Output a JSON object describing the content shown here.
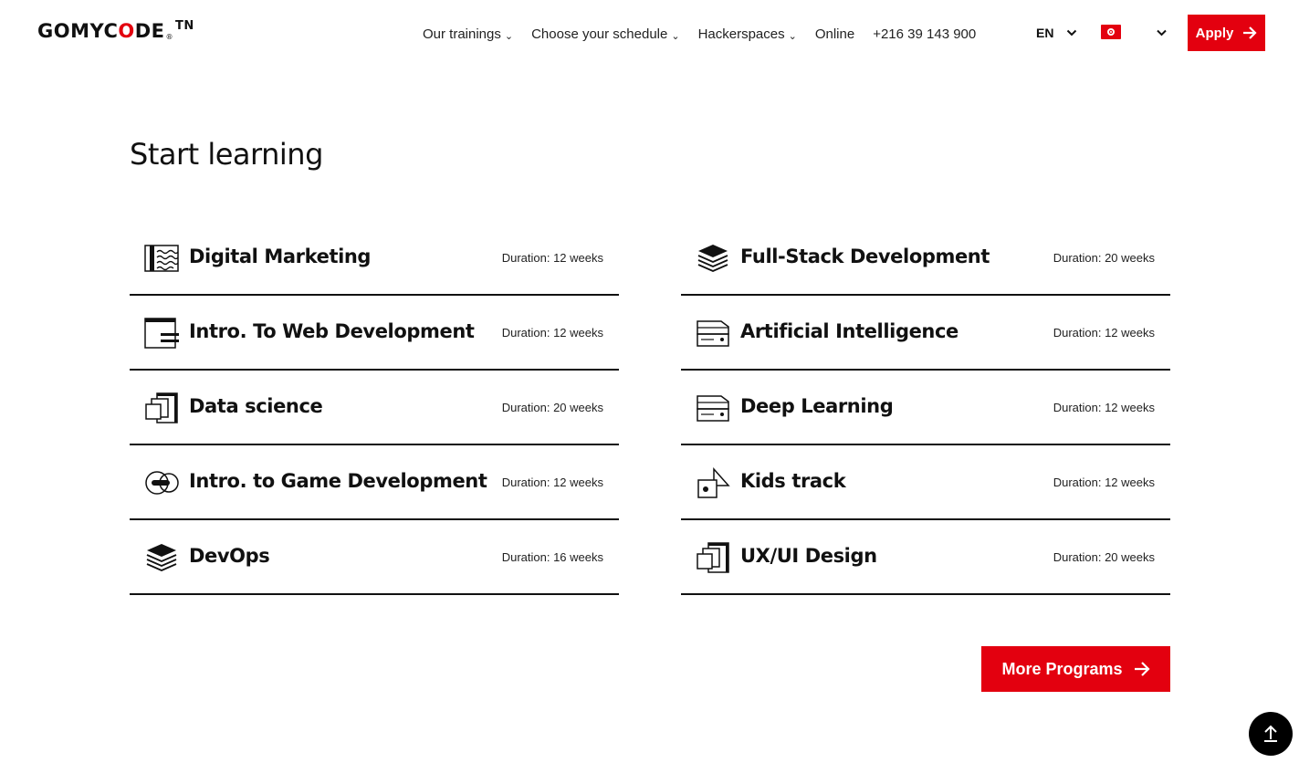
{
  "header": {
    "logo": {
      "text_before": "GOMYC",
      "text_o": "O",
      "text_after": "DE",
      "reg": "®",
      "suffix": "TN"
    },
    "nav": [
      {
        "label": "Our trainings",
        "has_dropdown": true
      },
      {
        "label": "Choose your schedule",
        "has_dropdown": true
      },
      {
        "label": "Hackerspaces",
        "has_dropdown": true
      },
      {
        "label": "Online",
        "has_dropdown": false
      },
      {
        "label": "+216 39 143 900",
        "has_dropdown": false
      }
    ],
    "language": "EN",
    "country_flag": "tunisia-flag-icon",
    "apply_label": "Apply"
  },
  "main": {
    "title": "Start learning",
    "programs_left": [
      {
        "name": "Digital Marketing",
        "duration": "Duration: 12 weeks",
        "icon": "waves-book-icon"
      },
      {
        "name": "Intro. To Web Development",
        "duration": "Duration: 12 weeks",
        "icon": "browser-window-icon"
      },
      {
        "name": "Data science",
        "duration": "Duration: 20 weeks",
        "icon": "stacked-squares-icon"
      },
      {
        "name": "Intro. to Game Development",
        "duration": "Duration: 12 weeks",
        "icon": "toggle-circle-icon"
      },
      {
        "name": "DevOps",
        "duration": "Duration: 16 weeks",
        "icon": "layers-icon"
      }
    ],
    "programs_right": [
      {
        "name": "Full-Stack Development",
        "duration": "Duration: 20 weeks",
        "icon": "layers-icon"
      },
      {
        "name": "Artificial Intelligence",
        "duration": "Duration: 12 weeks",
        "icon": "server-icon"
      },
      {
        "name": "Deep Learning",
        "duration": "Duration: 12 weeks",
        "icon": "server-icon"
      },
      {
        "name": "Kids track",
        "duration": "Duration: 12 weeks",
        "icon": "shapes-icon"
      },
      {
        "name": "UX/UI Design",
        "duration": "Duration: 20 weeks",
        "icon": "stacked-squares-icon"
      }
    ],
    "more_programs_label": "More Programs"
  },
  "colors": {
    "accent": "#e3000f",
    "text": "#111111",
    "background": "#ffffff"
  }
}
